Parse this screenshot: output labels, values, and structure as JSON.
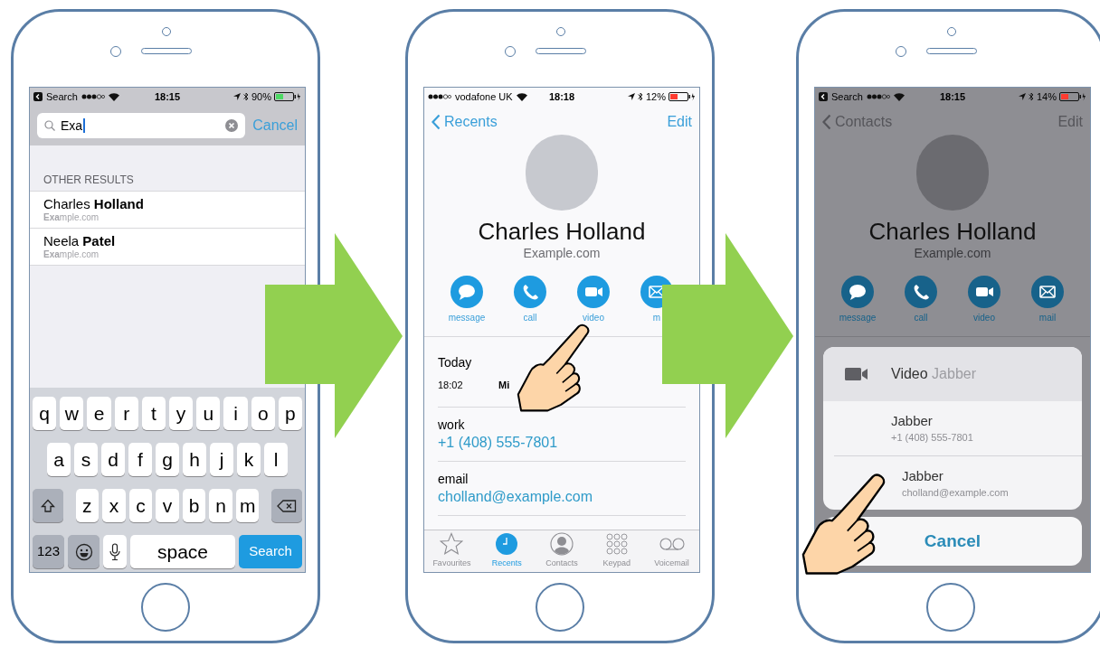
{
  "phones": [
    {
      "kind": "search",
      "status_bar": {
        "back_app": "Search",
        "time": "18:15",
        "battery": {
          "reading": "90%",
          "color": "#4cd964"
        }
      },
      "search": {
        "value": "Exa",
        "cancel": "Cancel"
      },
      "section_header": "OTHER RESULTS",
      "results": [
        {
          "name": "Charles **Holland**",
          "detail": "**Exa**mple.com"
        },
        {
          "name": "Neela **Patel**",
          "detail": "**Exa**mple.com"
        }
      ],
      "keyboard": {
        "rows": [
          [
            "q",
            "w",
            "e",
            "r",
            "t",
            "y",
            "u",
            "i",
            "o",
            "p"
          ],
          [
            "a",
            "s",
            "d",
            "f",
            "g",
            "h",
            "j",
            "k",
            "l"
          ],
          [
            "z",
            "x",
            "c",
            "v",
            "b",
            "n",
            "m"
          ]
        ],
        "numbers_key": "123",
        "space_key": "space",
        "action_key": "Search"
      }
    },
    {
      "kind": "contact",
      "dimmed": false,
      "status_bar": {
        "carrier": "vodafone UK",
        "time": "18:18",
        "battery": {
          "reading": "12%",
          "color": "#ff3b30"
        }
      },
      "nav": {
        "back": "Recents",
        "action": "Edit"
      },
      "contact": {
        "name": "Charles Holland",
        "company": "Example.com"
      },
      "actions": [
        {
          "kind": "message",
          "label": "message"
        },
        {
          "kind": "call",
          "label": "call"
        },
        {
          "kind": "video",
          "label": "video"
        },
        {
          "kind": "mail",
          "label": "m"
        }
      ],
      "recents": {
        "title": "Today",
        "time": "18:02",
        "status": "Mi"
      },
      "fields": [
        {
          "label": "work",
          "value": "+1 (408) 555-7801"
        },
        {
          "label": "email",
          "value": "cholland@example.com"
        }
      ],
      "tab_bar": [
        {
          "kind": "star",
          "label": "Favourites",
          "selected": false
        },
        {
          "kind": "clock",
          "label": "Recents",
          "selected": true
        },
        {
          "kind": "person",
          "label": "Contacts",
          "selected": false
        },
        {
          "kind": "keypad",
          "label": "Keypad",
          "selected": false
        },
        {
          "kind": "voicemail",
          "label": "Voicemail",
          "selected": false
        }
      ]
    },
    {
      "kind": "contact",
      "dimmed": true,
      "status_bar": {
        "back_app": "Search",
        "time": "18:15",
        "battery": {
          "reading": "14%",
          "color": "#ff3b30"
        }
      },
      "nav": {
        "back": "Contacts",
        "action": "Edit"
      },
      "contact": {
        "name": "Charles Holland",
        "company": "Example.com"
      },
      "actions": [
        {
          "kind": "message",
          "label": "message"
        },
        {
          "kind": "call",
          "label": "call"
        },
        {
          "kind": "video",
          "label": "video"
        },
        {
          "kind": "mail",
          "label": "mail"
        }
      ],
      "action_sheet": {
        "title": "Video",
        "subtitle": "Jabber",
        "options": [
          {
            "title": "Jabber",
            "detail": "+1 (408) 555-7801"
          },
          {
            "title": "Jabber",
            "detail": "cholland@example.com"
          }
        ],
        "cancel": "Cancel"
      }
    }
  ]
}
